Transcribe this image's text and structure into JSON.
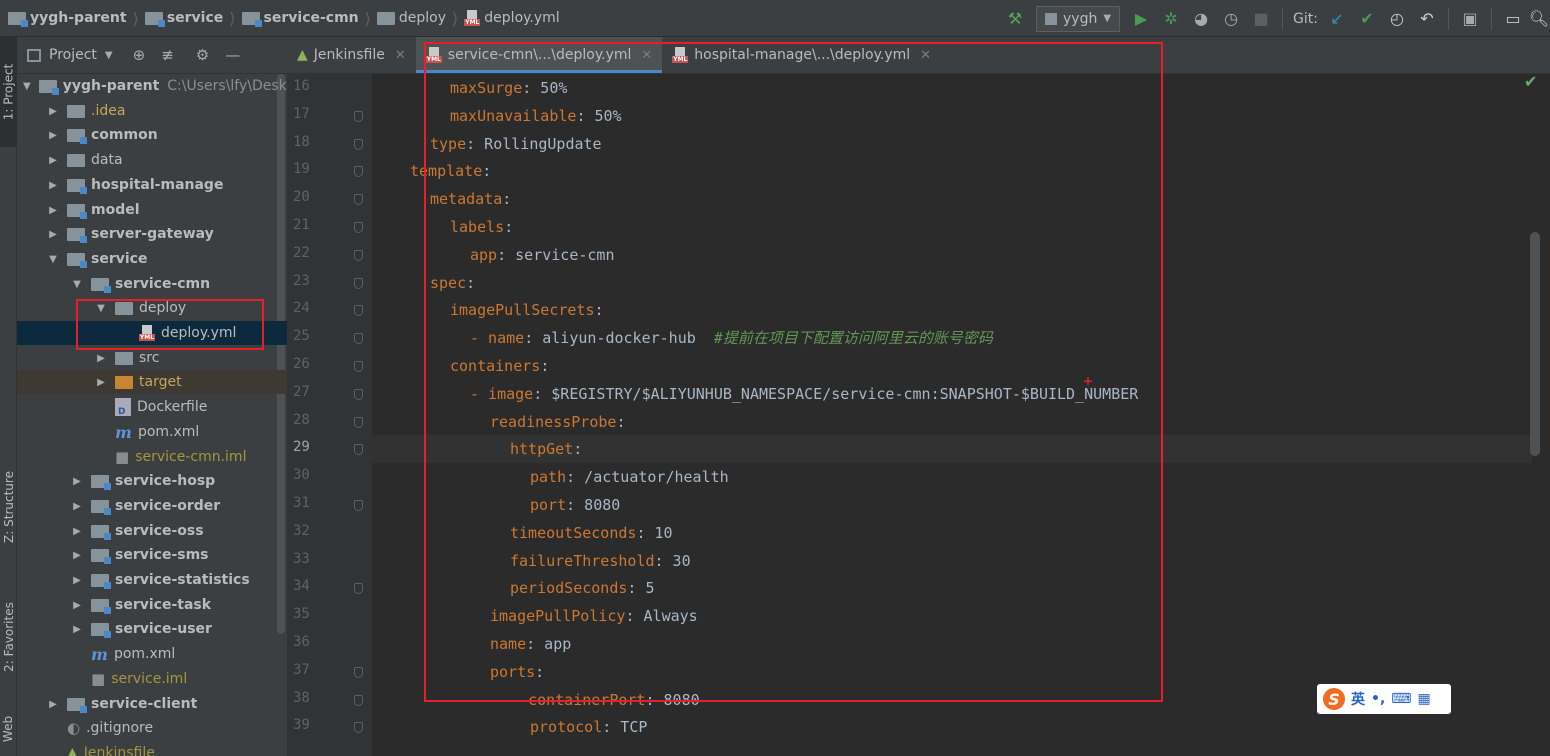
{
  "breadcrumb": [
    {
      "label": "yygh-parent",
      "bold": true,
      "icon": "module-folder"
    },
    {
      "label": "service",
      "bold": true,
      "icon": "module-folder"
    },
    {
      "label": "service-cmn",
      "bold": true,
      "icon": "module-folder"
    },
    {
      "label": "deploy",
      "bold": false,
      "icon": "folder"
    },
    {
      "label": "deploy.yml",
      "bold": false,
      "icon": "yml-file"
    }
  ],
  "toolbar": {
    "run_config": "yygh",
    "git_label": "Git:",
    "yml_badge": "YML"
  },
  "side_tabs": {
    "project": "1: Project",
    "structure": "Z: Structure",
    "favorites": "2: Favorites",
    "web": "Web"
  },
  "project_panel": {
    "title": "Project",
    "tree": [
      {
        "label": "yygh-parent",
        "path": "C:\\Users\\lfy\\Deskto",
        "indent": 0,
        "expanded": true,
        "icon": "module-folder",
        "style": "bold"
      },
      {
        "label": ".idea",
        "indent": 1,
        "expanded": false,
        "icon": "folder",
        "style": "orange"
      },
      {
        "label": "common",
        "indent": 1,
        "expanded": false,
        "icon": "module-folder",
        "style": "bold"
      },
      {
        "label": "data",
        "indent": 1,
        "expanded": false,
        "icon": "folder",
        "style": "normal"
      },
      {
        "label": "hospital-manage",
        "indent": 1,
        "expanded": false,
        "icon": "module-folder",
        "style": "bold"
      },
      {
        "label": "model",
        "indent": 1,
        "expanded": false,
        "icon": "module-folder",
        "style": "bold"
      },
      {
        "label": "server-gateway",
        "indent": 1,
        "expanded": false,
        "icon": "module-folder",
        "style": "bold"
      },
      {
        "label": "service",
        "indent": 1,
        "expanded": true,
        "icon": "module-folder",
        "style": "bold"
      },
      {
        "label": "service-cmn",
        "indent": 2,
        "expanded": true,
        "icon": "module-folder",
        "style": "bold"
      },
      {
        "label": "deploy",
        "indent": 3,
        "expanded": true,
        "icon": "folder",
        "style": "normal"
      },
      {
        "label": "deploy.yml",
        "indent": 4,
        "expanded": null,
        "icon": "yml-file",
        "style": "normal",
        "selected": true
      },
      {
        "label": "src",
        "indent": 3,
        "expanded": false,
        "icon": "folder",
        "style": "normal"
      },
      {
        "label": "target",
        "indent": 3,
        "expanded": false,
        "icon": "orange-folder",
        "style": "orange",
        "excluded": true
      },
      {
        "label": "Dockerfile",
        "indent": 3,
        "expanded": null,
        "icon": "docker-file",
        "style": "normal"
      },
      {
        "label": "pom.xml",
        "indent": 3,
        "expanded": null,
        "icon": "maven-file",
        "style": "normal"
      },
      {
        "label": "service-cmn.iml",
        "indent": 3,
        "expanded": null,
        "icon": "iml-file",
        "style": "olive"
      },
      {
        "label": "service-hosp",
        "indent": 2,
        "expanded": false,
        "icon": "module-folder",
        "style": "bold"
      },
      {
        "label": "service-order",
        "indent": 2,
        "expanded": false,
        "icon": "module-folder",
        "style": "bold"
      },
      {
        "label": "service-oss",
        "indent": 2,
        "expanded": false,
        "icon": "module-folder",
        "style": "bold"
      },
      {
        "label": "service-sms",
        "indent": 2,
        "expanded": false,
        "icon": "module-folder",
        "style": "bold"
      },
      {
        "label": "service-statistics",
        "indent": 2,
        "expanded": false,
        "icon": "module-folder",
        "style": "bold"
      },
      {
        "label": "service-task",
        "indent": 2,
        "expanded": false,
        "icon": "module-folder",
        "style": "bold"
      },
      {
        "label": "service-user",
        "indent": 2,
        "expanded": false,
        "icon": "module-folder",
        "style": "bold"
      },
      {
        "label": "pom.xml",
        "indent": 2,
        "expanded": null,
        "icon": "maven-file",
        "style": "normal"
      },
      {
        "label": "service.iml",
        "indent": 2,
        "expanded": null,
        "icon": "iml-file",
        "style": "olive"
      },
      {
        "label": "service-client",
        "indent": 1,
        "expanded": false,
        "icon": "module-folder",
        "style": "bold"
      },
      {
        "label": ".gitignore",
        "indent": 1,
        "expanded": null,
        "icon": "gitignore-file",
        "style": "normal"
      },
      {
        "label": "Jenkinsfile",
        "indent": 1,
        "expanded": null,
        "icon": "jenkins-file",
        "style": "olive"
      }
    ]
  },
  "tabs": [
    {
      "label": "Jenkinsfile",
      "icon": "jenkins-file",
      "active": false
    },
    {
      "label": "service-cmn\\...\\deploy.yml",
      "icon": "yml-file",
      "active": true
    },
    {
      "label": "hospital-manage\\...\\deploy.yml",
      "icon": "yml-file",
      "active": false
    }
  ],
  "editor": {
    "current_line": 29,
    "lines": [
      {
        "n": 16,
        "indent": 6,
        "key": "maxSurge",
        "value": " 50%",
        "comment": "",
        "fold": false
      },
      {
        "n": 17,
        "indent": 6,
        "key": "maxUnavailable",
        "value": " 50%",
        "comment": "",
        "fold": true
      },
      {
        "n": 18,
        "indent": 4,
        "key": "type",
        "value": " RollingUpdate",
        "comment": "",
        "fold": true
      },
      {
        "n": 19,
        "indent": 2,
        "key": "template",
        "value": "",
        "comment": "",
        "fold": true
      },
      {
        "n": 20,
        "indent": 4,
        "key": "metadata",
        "value": "",
        "comment": "",
        "fold": true
      },
      {
        "n": 21,
        "indent": 6,
        "key": "labels",
        "value": "",
        "comment": "",
        "fold": true
      },
      {
        "n": 22,
        "indent": 8,
        "key": "app",
        "value": " service-cmn",
        "comment": "",
        "fold": true
      },
      {
        "n": 23,
        "indent": 4,
        "key": "spec",
        "value": "",
        "comment": "",
        "fold": true
      },
      {
        "n": 24,
        "indent": 6,
        "key": "imagePullSecrets",
        "value": "",
        "comment": "",
        "fold": true
      },
      {
        "n": 25,
        "indent": 8,
        "key": "- name",
        "value": " aliyun-docker-hub  ",
        "comment": "#提前在项目下配置访问阿里云的账号密码",
        "fold": true
      },
      {
        "n": 26,
        "indent": 6,
        "key": "containers",
        "value": "",
        "comment": "",
        "fold": true
      },
      {
        "n": 27,
        "indent": 8,
        "key": "- image",
        "value": " $REGISTRY/$ALIYUNHUB_NAMESPACE/service-cmn:SNAPSHOT-$BUILD_NUMBER",
        "comment": "",
        "fold": true
      },
      {
        "n": 28,
        "indent": 10,
        "key": "readinessProbe",
        "value": "",
        "comment": "",
        "fold": true
      },
      {
        "n": 29,
        "indent": 12,
        "key": "httpGet",
        "value": "",
        "comment": "",
        "fold": true
      },
      {
        "n": 30,
        "indent": 14,
        "key": "path",
        "value": " /actuator/health",
        "comment": "",
        "fold": false
      },
      {
        "n": 31,
        "indent": 14,
        "key": "port",
        "value": " 8080",
        "comment": "",
        "fold": true
      },
      {
        "n": 32,
        "indent": 12,
        "key": "timeoutSeconds",
        "value": " 10",
        "comment": "",
        "fold": false
      },
      {
        "n": 33,
        "indent": 12,
        "key": "failureThreshold",
        "value": " 30",
        "comment": "",
        "fold": false
      },
      {
        "n": 34,
        "indent": 12,
        "key": "periodSeconds",
        "value": " 5",
        "comment": "",
        "fold": true
      },
      {
        "n": 35,
        "indent": 10,
        "key": "imagePullPolicy",
        "value": " Always",
        "comment": "",
        "fold": false
      },
      {
        "n": 36,
        "indent": 10,
        "key": "name",
        "value": " app",
        "comment": "",
        "fold": false
      },
      {
        "n": 37,
        "indent": 10,
        "key": "ports",
        "value": "",
        "comment": "",
        "fold": true
      },
      {
        "n": 38,
        "indent": 12,
        "key": "- containerPort",
        "value": " 8080",
        "comment": "",
        "fold": true
      },
      {
        "n": 39,
        "indent": 14,
        "key": "protocol",
        "value": " TCP",
        "comment": "",
        "fold": true
      }
    ]
  },
  "ime": {
    "logo": "S",
    "lang": "英",
    "marks": "•,"
  },
  "colors": {
    "key": "#cc7832",
    "value": "#a9b7c6",
    "comment": "#629755",
    "annotation": "#e5202a",
    "selection": "#0d293e"
  }
}
